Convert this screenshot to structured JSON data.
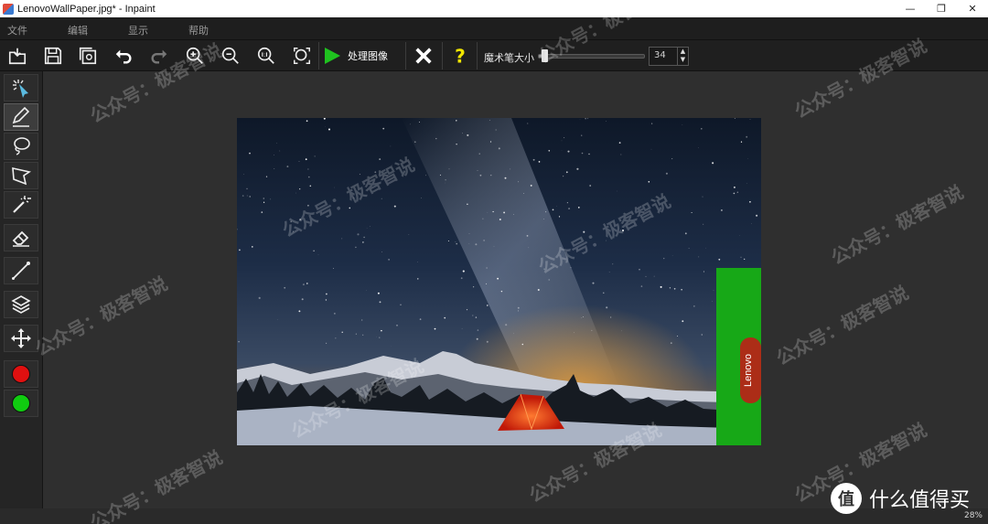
{
  "window": {
    "title": "LenovoWallPaper.jpg* - Inpaint",
    "minimize_glyph": "—",
    "restore_glyph": "❐",
    "close_glyph": "✕"
  },
  "menu": {
    "items": [
      {
        "label": "文件"
      },
      {
        "label": "编辑"
      },
      {
        "label": "显示"
      },
      {
        "label": "帮助"
      }
    ]
  },
  "toolbar": {
    "icons": [
      "open-icon",
      "save-icon",
      "save-as-icon",
      "undo-icon",
      "redo-icon",
      "zoom-in-icon",
      "zoom-out-icon",
      "zoom-actual-icon",
      "zoom-fit-icon"
    ],
    "process_label": "处理图像",
    "brush_size_label": "魔术笔大小",
    "brush_size_value": "34",
    "brush_size_fraction": 0.05,
    "accent_green": "#1fc21f",
    "help_color": "#f2e600"
  },
  "tools": {
    "icons": [
      "marker-select-icon",
      "pencil-icon",
      "lasso-icon",
      "polygon-lasso-icon",
      "magic-wand-icon",
      "eraser-icon",
      "line-icon",
      "layers-icon",
      "move-icon"
    ],
    "color_red": "#e01010",
    "color_green": "#10cc10"
  },
  "canvas": {
    "mask_color": "#17a817",
    "product_label": "Lenovo"
  },
  "status": {
    "zoom": "28%"
  },
  "watermark": {
    "text": "公众号：极客智说",
    "brand_text": "什么值得买",
    "brand_glyph": "值"
  }
}
